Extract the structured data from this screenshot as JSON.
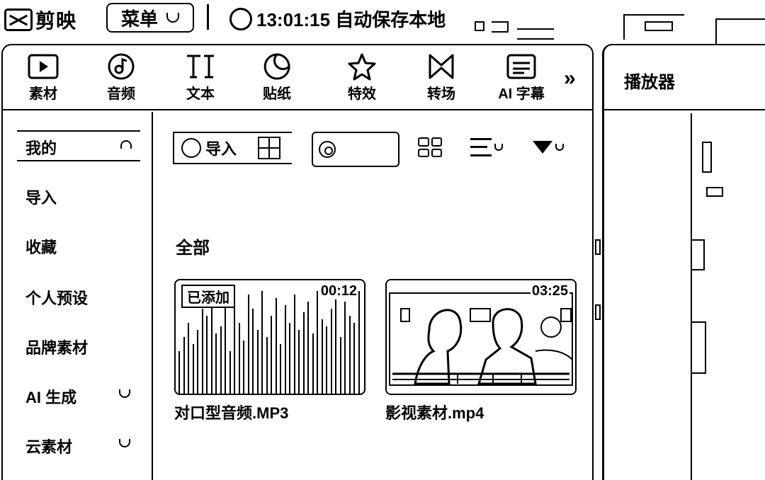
{
  "app": {
    "name": "剪映",
    "menu_label": "菜单",
    "save_status": "13:01:15 自动保存本地"
  },
  "toolbar": {
    "tools": [
      {
        "label": "素材",
        "icon": "media-icon"
      },
      {
        "label": "音频",
        "icon": "audio-icon"
      },
      {
        "label": "文本",
        "icon": "text-icon"
      },
      {
        "label": "贴纸",
        "icon": "sticker-icon"
      },
      {
        "label": "特效",
        "icon": "effects-icon"
      },
      {
        "label": "转场",
        "icon": "transition-icon"
      },
      {
        "label": "AI 字幕",
        "icon": "subtitle-icon"
      }
    ],
    "more": "»"
  },
  "sidebar": {
    "items": [
      {
        "label": "我的"
      },
      {
        "label": "导入"
      },
      {
        "label": "收藏"
      },
      {
        "label": "个人预设"
      },
      {
        "label": "品牌素材"
      },
      {
        "label": "AI 生成"
      },
      {
        "label": "云素材"
      }
    ]
  },
  "content": {
    "import_label": "导入",
    "search_placeholder": "",
    "section_title": "全部",
    "media": [
      {
        "name": "对口型音频.MP3",
        "duration": "00:12",
        "badge": "已添加",
        "kind": "audio"
      },
      {
        "name": "影视素材.mp4",
        "duration": "03:25",
        "kind": "video"
      }
    ]
  },
  "player": {
    "title": "播放器"
  }
}
